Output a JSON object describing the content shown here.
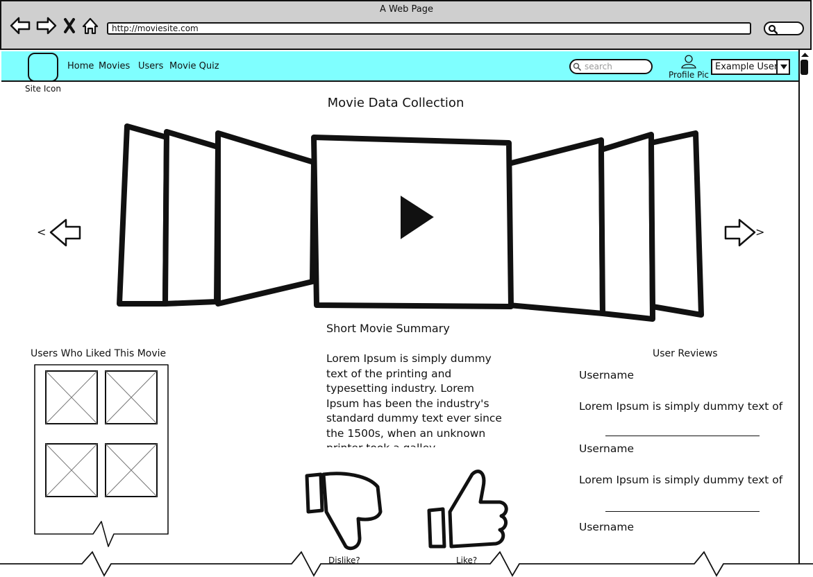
{
  "window": {
    "title": "A Web Page"
  },
  "browser": {
    "url": "http://moviesite.com",
    "icons": [
      "back-icon",
      "forward-icon",
      "close-icon",
      "home-icon",
      "search-icon"
    ]
  },
  "nav": {
    "site_icon_label": "Site Icon",
    "links": [
      "Home",
      "Movies",
      "Users",
      "Movie Quiz"
    ],
    "search_placeholder": "search",
    "profile_label": "Profile Pic",
    "user_selected": "Example User",
    "accent_color": "#7fffff"
  },
  "main": {
    "title": "Movie Data Collection",
    "summary_title": "Short Movie Summary",
    "summary_text": "Lorem Ipsum is simply dummy text of the printing and typesetting industry. Lorem Ipsum has been the industry's standard dummy text ever since the 1500s, when an unknown printer took a galley",
    "carousel_prev": "<",
    "carousel_next": ">"
  },
  "liked_users": {
    "title": "Users Who Liked This Movie"
  },
  "reviews": {
    "title": "User Reviews",
    "items": [
      {
        "username": "Username",
        "text": "Lorem Ipsum is simply dummy text of the printing and typesetting industry"
      },
      {
        "username": "Username",
        "text": "Lorem Ipsum is simply dummy text of the printing and typesetting industry"
      },
      {
        "username": "Username"
      }
    ]
  },
  "rating": {
    "dislike_label": "Dislike?",
    "like_label": "Like?"
  }
}
